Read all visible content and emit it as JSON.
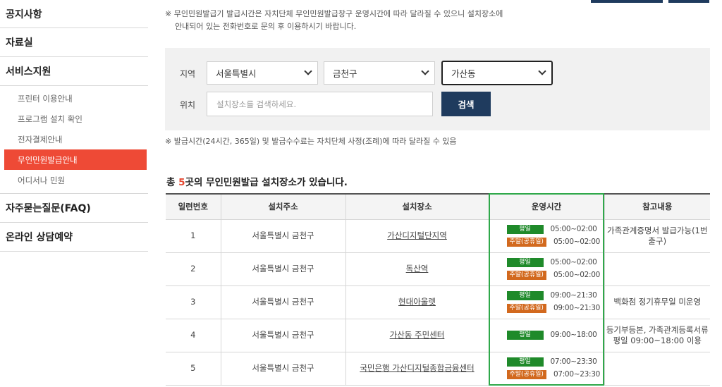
{
  "sidebar": {
    "items": [
      "공지사항",
      "자료실",
      "서비스지원"
    ],
    "sub_items": [
      "프린터 이용안내",
      "프로그램 설치 확인",
      "전자결제안내",
      "무인민원발급안내",
      "어디서나 민원"
    ],
    "bottom_items": [
      "자주묻는질문(FAQ)",
      "온라인 상담예약"
    ]
  },
  "notice": {
    "line1": "※ 무인민원발급기 발급시간은 자치단체 무인민원발급창구 운영시간에 따라 달라질 수 있으니 설치장소에",
    "line2": "안내되어 있는 전화번호로 문의 후 이용하시기 바랍니다.",
    "fee": "※ 발급시간(24시간, 365일) 및 발급수수료는 자치단체 사정(조례)에 따라 달라질 수 있음"
  },
  "search": {
    "region_label": "지역",
    "location_label": "위치",
    "city": "서울특별시",
    "district": "금천구",
    "dong": "가산동",
    "placeholder": "설치장소를 검색하세요.",
    "button": "검색"
  },
  "result": {
    "prefix": "총 ",
    "count": "5",
    "suffix": "곳의 무인민원발급 설치장소가 있습니다."
  },
  "table": {
    "headers": [
      "일련번호",
      "설치주소",
      "설치장소",
      "운영시간",
      "참고내용"
    ],
    "weekday_label": "평일",
    "holiday_label": "주말(공휴일)",
    "rows": [
      {
        "no": "1",
        "address": "서울특별시 금천구",
        "place": "가산디지털단지역",
        "weekday": "05:00~02:00",
        "holiday": "05:00~02:00",
        "note": "가족관계증명서 발급가능(1번 출구)"
      },
      {
        "no": "2",
        "address": "서울특별시 금천구",
        "place": "독산역",
        "weekday": "05:00~02:00",
        "holiday": "05:00~02:00",
        "note": ""
      },
      {
        "no": "3",
        "address": "서울특별시 금천구",
        "place": "현대아울렛",
        "weekday": "09:00~21:30",
        "holiday": "09:00~21:30",
        "note": "백화점 정기휴무일 미운영"
      },
      {
        "no": "4",
        "address": "서울특별시 금천구",
        "place": "가산동 주민센터",
        "weekday": "09:00~18:00",
        "holiday": "",
        "note": "등기부등본, 가족관계등록서류 평일 09:00~18:00 이용"
      },
      {
        "no": "5",
        "address": "서울특별시 금천구",
        "place": "국민은행 가산디지털종합금융센터",
        "weekday": "07:00~23:30",
        "holiday": "07:00~23:30",
        "note": ""
      }
    ]
  }
}
